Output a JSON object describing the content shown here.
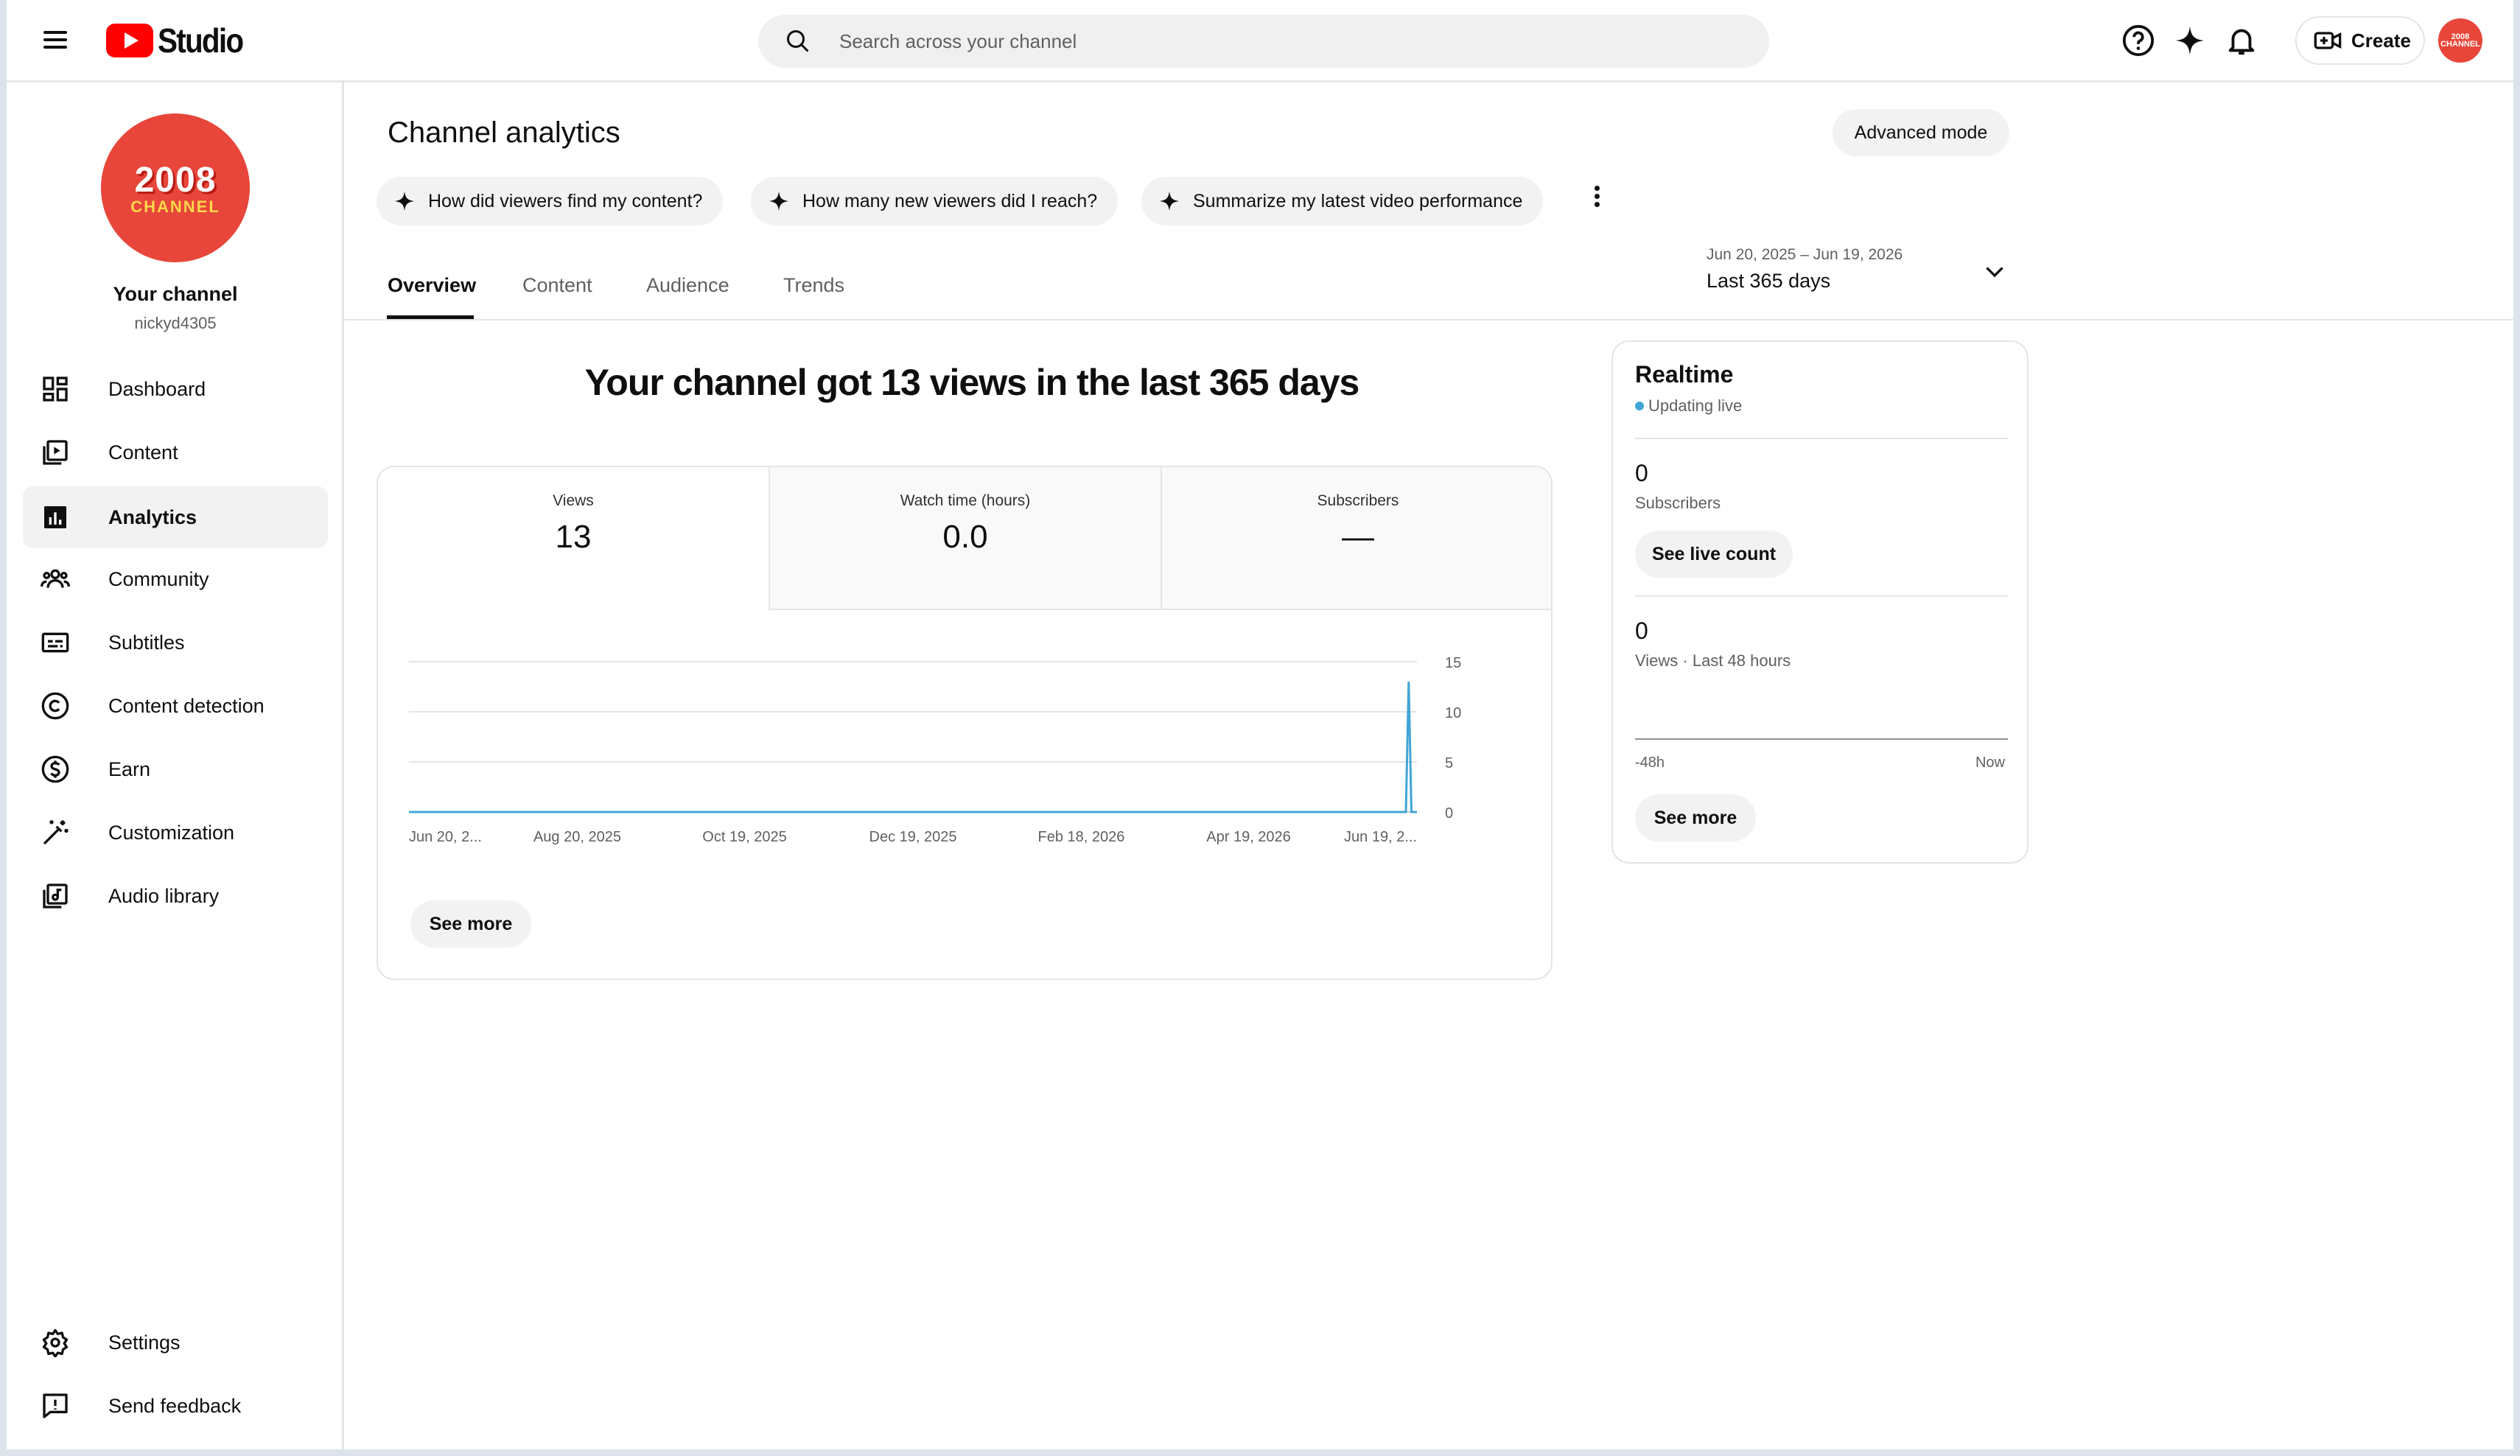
{
  "header": {
    "logo_text": "Studio",
    "search_placeholder": "Search across your channel",
    "create_label": "Create",
    "avatar_text": "2008 CHANNEL"
  },
  "sidebar": {
    "avatar_line1": "2008",
    "avatar_line2": "CHANNEL",
    "channel_label": "Your channel",
    "handle": "nickyd4305",
    "items": [
      {
        "label": "Dashboard",
        "icon": "dashboard-icon"
      },
      {
        "label": "Content",
        "icon": "content-icon"
      },
      {
        "label": "Analytics",
        "icon": "analytics-icon",
        "active": true
      },
      {
        "label": "Community",
        "icon": "community-icon"
      },
      {
        "label": "Subtitles",
        "icon": "subtitles-icon"
      },
      {
        "label": "Content detection",
        "icon": "copyright-icon"
      },
      {
        "label": "Earn",
        "icon": "dollar-icon"
      },
      {
        "label": "Customization",
        "icon": "magic-wand-icon"
      },
      {
        "label": "Audio library",
        "icon": "audio-library-icon"
      }
    ],
    "bottom_items": [
      {
        "label": "Settings",
        "icon": "gear-icon"
      },
      {
        "label": "Send feedback",
        "icon": "feedback-icon"
      }
    ]
  },
  "main": {
    "title": "Channel analytics",
    "advanced_mode": "Advanced mode",
    "chips": [
      "How did viewers find my content?",
      "How many new viewers did I reach?",
      "Summarize my latest video performance"
    ],
    "tabs": [
      "Overview",
      "Content",
      "Audience",
      "Trends"
    ],
    "active_tab": "Overview",
    "date_range": "Jun 20, 2025 – Jun 19, 2026",
    "date_label": "Last 365 days",
    "headline": "Your channel got 13 views in the last 365 days",
    "metrics": [
      {
        "label": "Views",
        "value": "13",
        "selected": true
      },
      {
        "label": "Watch time (hours)",
        "value": "0.0"
      },
      {
        "label": "Subscribers",
        "value": "—"
      }
    ],
    "see_more": "See more"
  },
  "chart_data": {
    "type": "line",
    "x_tick_labels": [
      "Jun 20, 2...",
      "Aug 20, 2025",
      "Oct 19, 2025",
      "Dec 19, 2025",
      "Feb 18, 2026",
      "Apr 19, 2026",
      "Jun 19, 2..."
    ],
    "y_ticks": [
      0,
      5,
      10,
      15
    ],
    "ylim": [
      0,
      15
    ],
    "series": [
      {
        "points": [
          [
            0,
            0
          ],
          [
            361,
            0
          ],
          [
            362,
            13
          ],
          [
            363,
            0
          ],
          [
            365,
            0
          ]
        ]
      }
    ],
    "x_range": [
      0,
      365
    ],
    "line_color": "#41a5d6"
  },
  "realtime": {
    "title": "Realtime",
    "status": "Updating live",
    "subscribers_value": "0",
    "subscribers_label": "Subscribers",
    "live_count_btn": "See live count",
    "views_value": "0",
    "views_label": "Views · Last 48 hours",
    "axis_start": "-48h",
    "axis_end": "Now",
    "see_more": "See more"
  }
}
